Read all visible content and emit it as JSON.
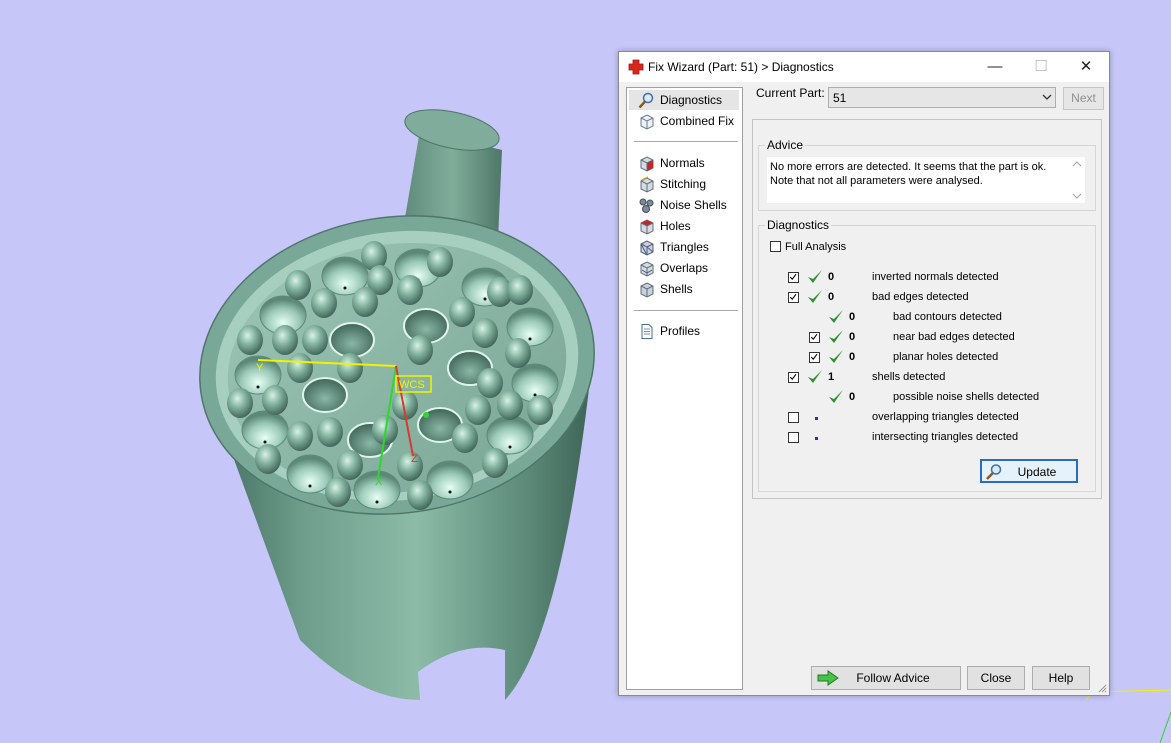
{
  "viewport": {
    "wcs_label": "WCS",
    "axis_y": "Y",
    "axis_x": "X",
    "axis_z": "Z"
  },
  "window": {
    "title": "Fix Wizard (Part: 51) > Diagnostics",
    "minimize": "—",
    "maximize": "☐",
    "close": "✕"
  },
  "nav": {
    "items": [
      {
        "label": "Diagnostics",
        "icon": "magnifier-icon"
      },
      {
        "label": "Combined Fix",
        "icon": "cube-icon"
      },
      {
        "label": "Normals",
        "icon": "normals-cube-icon"
      },
      {
        "label": "Stitching",
        "icon": "stitching-cube-icon"
      },
      {
        "label": "Noise Shells",
        "icon": "noise-shells-icon"
      },
      {
        "label": "Holes",
        "icon": "holes-cube-icon"
      },
      {
        "label": "Triangles",
        "icon": "triangles-cube-icon"
      },
      {
        "label": "Overlaps",
        "icon": "overlaps-cube-icon"
      },
      {
        "label": "Shells",
        "icon": "shells-cube-icon"
      },
      {
        "label": "Profiles",
        "icon": "document-icon"
      }
    ]
  },
  "current_part": {
    "label": "Current Part:",
    "value": "51",
    "next": "Next"
  },
  "advice": {
    "title": "Advice",
    "line1": "No more errors are detected. It seems that the part is ok.",
    "line2": "Note that not all parameters were analysed."
  },
  "diagnostics": {
    "title": "Diagnostics",
    "full_analysis": "Full Analysis",
    "rows": [
      {
        "checked": true,
        "status": "ok",
        "count": "0",
        "label": "inverted normals detected",
        "indent": 0
      },
      {
        "checked": true,
        "status": "ok",
        "count": "0",
        "label": "bad edges detected",
        "indent": 0
      },
      {
        "checked": null,
        "status": "ok",
        "count": "0",
        "label": "bad contours detected",
        "indent": 1
      },
      {
        "checked": true,
        "status": "ok",
        "count": "0",
        "label": "near bad edges detected",
        "indent": 1
      },
      {
        "checked": true,
        "status": "ok",
        "count": "0",
        "label": "planar holes detected",
        "indent": 1
      },
      {
        "checked": true,
        "status": "ok",
        "count": "1",
        "label": "shells detected",
        "indent": 0
      },
      {
        "checked": null,
        "status": "ok",
        "count": "0",
        "label": "possible noise shells detected",
        "indent": 1
      },
      {
        "checked": false,
        "status": "pending",
        "count": "",
        "label": "overlapping triangles detected",
        "indent": 0
      },
      {
        "checked": false,
        "status": "pending",
        "count": "",
        "label": "intersecting triangles detected",
        "indent": 0
      }
    ],
    "update": "Update"
  },
  "footer": {
    "follow_advice": "Follow Advice",
    "close": "Close",
    "help": "Help"
  },
  "colors": {
    "background": "#c6c6f8",
    "part": "#6f9d8c",
    "check_green": "#2f8f2f",
    "title_icon_red": "#d9261c"
  }
}
